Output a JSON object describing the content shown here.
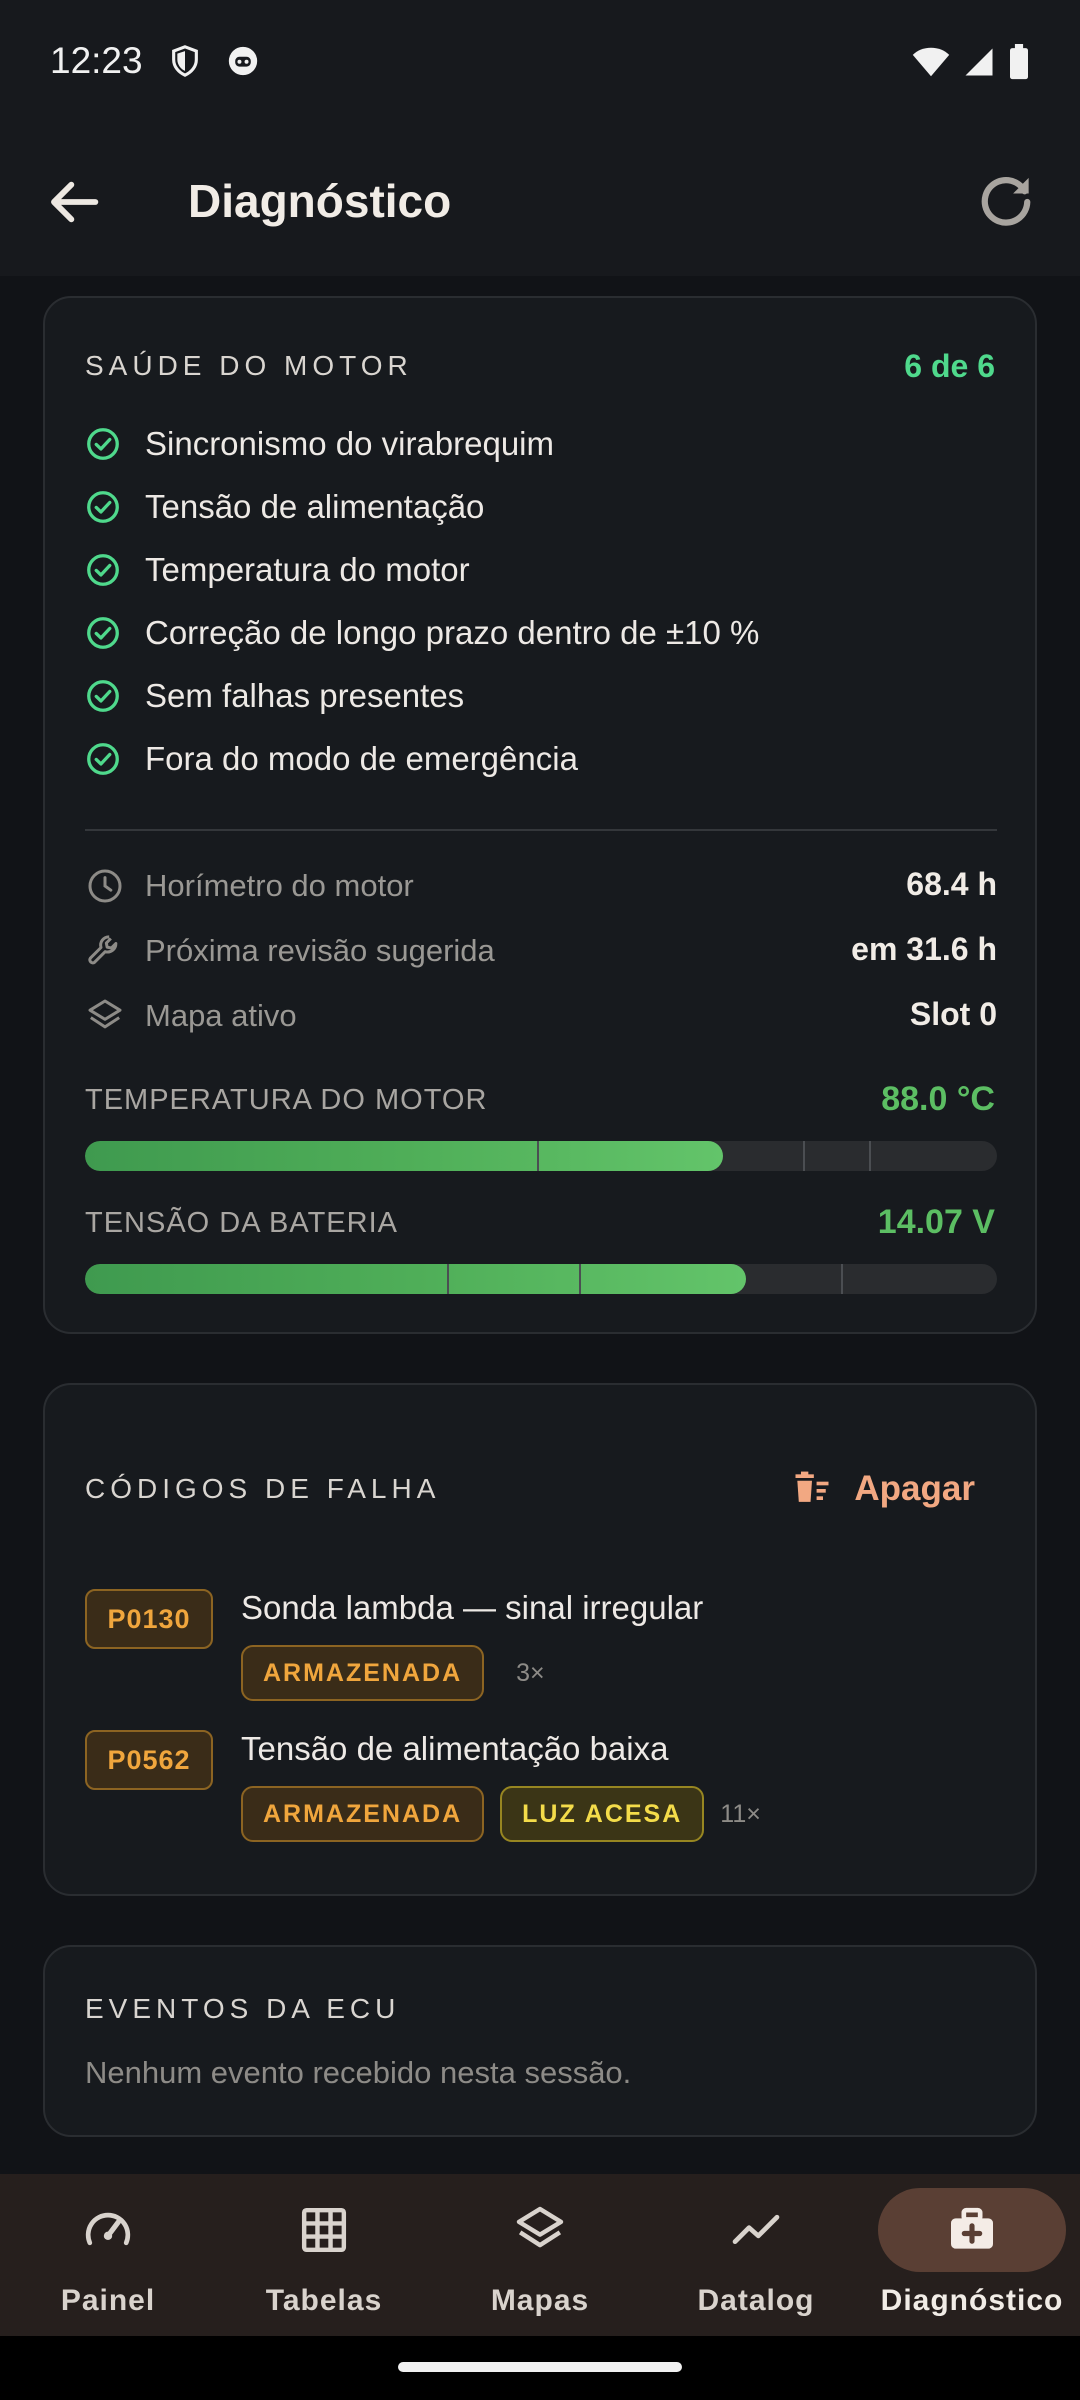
{
  "status_bar": {
    "time": "12:23"
  },
  "app_bar": {
    "title": "Diagnóstico"
  },
  "health": {
    "title": "SAÚDE DO MOTOR",
    "count": "6 de 6",
    "checks": [
      "Sincronismo do virabrequim",
      "Tensão de alimentação",
      "Temperatura do motor",
      "Correção de longo prazo dentro de ±10 %",
      "Sem falhas presentes",
      "Fora do modo de emergência"
    ],
    "info": [
      {
        "icon": "clock-icon",
        "label": "Horímetro do motor",
        "value": "68.4 h"
      },
      {
        "icon": "wrench-icon",
        "label": "Próxima revisão sugerida",
        "value": "em 31.6 h"
      },
      {
        "icon": "layers-icon",
        "label": "Mapa ativo",
        "value": "Slot 0"
      }
    ],
    "gauges": [
      {
        "label": "TEMPERATURA DO MOTOR",
        "value": "88.0 °C",
        "fill_fraction": 0.7
      },
      {
        "label": "TENSÃO DA BATERIA",
        "value": "14.07 V",
        "fill_fraction": 0.725
      }
    ]
  },
  "faults": {
    "title": "CÓDIGOS DE FALHA",
    "clear_label": "Apagar",
    "items": [
      {
        "code": "P0130",
        "description": "Sonda lambda — sinal irregular",
        "tags": [
          "ARMAZENADA"
        ],
        "count": "3×"
      },
      {
        "code": "P0562",
        "description": "Tensão de alimentação baixa",
        "tags": [
          "ARMAZENADA",
          "LUZ ACESA"
        ],
        "count": "11×"
      }
    ]
  },
  "events": {
    "title": "EVENTOS DA ECU",
    "empty": "Nenhum evento recebido nesta sessão."
  },
  "nav": [
    {
      "label": "Painel",
      "icon": "gauge-icon",
      "active": false
    },
    {
      "label": "Tabelas",
      "icon": "grid-icon",
      "active": false
    },
    {
      "label": "Mapas",
      "icon": "layers-icon",
      "active": false
    },
    {
      "label": "Datalog",
      "icon": "chart-line-icon",
      "active": false
    },
    {
      "label": "Diagnóstico",
      "icon": "medical-kit-icon",
      "active": true
    }
  ],
  "colors": {
    "ok_green": "#4fd98c",
    "gauge_green": "#5cbe63",
    "accent_orange": "#f2a882",
    "stored_amber": "#f0a63d",
    "lamp_yellow": "#f4dc4a"
  }
}
